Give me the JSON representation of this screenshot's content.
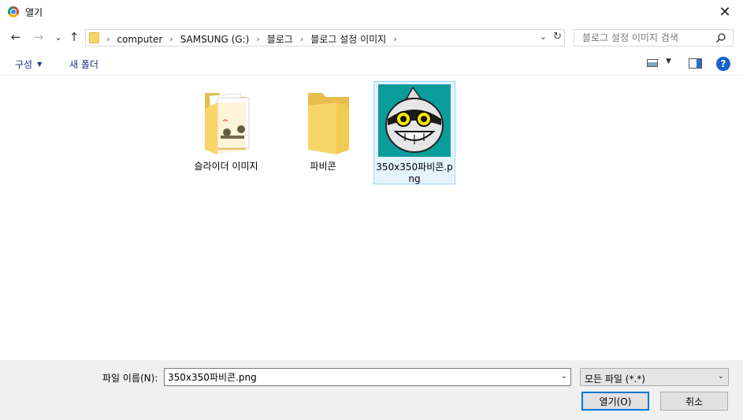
{
  "window": {
    "title": "열기",
    "close_glyph": "✕"
  },
  "nav": {
    "back_glyph": "←",
    "forward_glyph": "→",
    "recent_glyph": "⌄",
    "up_glyph": "↑",
    "breadcrumbs": [
      "computer",
      "SAMSUNG (G:)",
      "블로그",
      "블로그 설정 이미지"
    ],
    "separator": "›",
    "dropdown_glyph": "⌄",
    "refresh_glyph": "↻",
    "search_placeholder": "블로그 설정 이미지 검색"
  },
  "toolbar": {
    "organize_label": "구성",
    "new_folder_label": "새 폴더",
    "help_glyph": "?"
  },
  "files": [
    {
      "name": "슬라이더 이미지",
      "type": "folder-with-contents"
    },
    {
      "name": "파비콘",
      "type": "folder"
    },
    {
      "name": "350x350파비콘.png",
      "type": "image",
      "selected": true
    }
  ],
  "footer": {
    "filename_label": "파일 이름(N):",
    "filename_value": "350x350파비콘.png",
    "filter_value": "모든 파일 (*.*)",
    "open_label": "열기(O)",
    "cancel_label": "취소"
  },
  "colors": {
    "accent": "#0078d7",
    "folder": "#f8d568",
    "selection": "#e5f3ff",
    "thumb_bg": "#0b9c9c"
  }
}
